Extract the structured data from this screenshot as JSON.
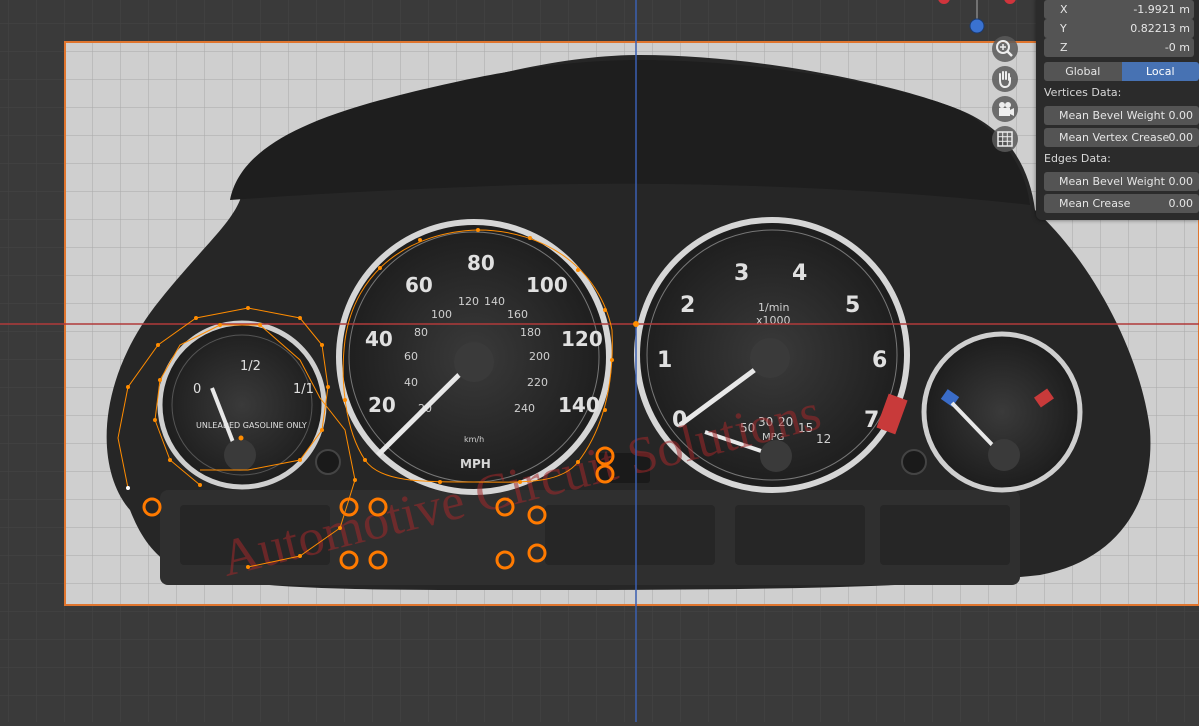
{
  "panel": {
    "x_label": "X",
    "x_value": "-1.9921 m",
    "y_label": "Y",
    "y_value": "0.82213 m",
    "z_label": "Z",
    "z_value": "-0 m",
    "global_label": "Global",
    "local_label": "Local",
    "vertices_header": "Vertices Data:",
    "mean_bevel_weight_label": "Mean Bevel Weight",
    "mean_bevel_weight_value": "0.00",
    "mean_vertex_crease_label": "Mean Vertex Crease",
    "mean_vertex_crease_value": "0.00",
    "edges_header": "Edges Data:",
    "edge_mean_bevel_weight_label": "Mean Bevel Weight",
    "edge_mean_bevel_weight_value": "0.00",
    "mean_crease_label": "Mean Crease",
    "mean_crease_value": "0.00"
  },
  "nav_icons": [
    "zoom-icon",
    "hand-pan-icon",
    "camera-icon",
    "grid-ortho-icon"
  ],
  "cluster": {
    "speedo_ticks": [
      "20",
      "40",
      "60",
      "80",
      "100",
      "120",
      "140"
    ],
    "speedo_inner": [
      "20",
      "40",
      "60",
      "80",
      "100",
      "120",
      "140",
      "160",
      "180",
      "200",
      "220",
      "240"
    ],
    "speedo_unit": "MPH",
    "speedo_kmh": "km/h",
    "tach_ticks": [
      "0",
      "1",
      "2",
      "3",
      "4",
      "5",
      "6",
      "7"
    ],
    "tach_unit": "1/min",
    "tach_mult": "x1000",
    "mpg_ticks": [
      "50",
      "30",
      "20",
      "15",
      "12"
    ],
    "mpg_label": "MPG",
    "fuel_labels": [
      "0",
      "1/2",
      "1/1"
    ],
    "fuel_text": "UNLEADED GASOLINE ONLY",
    "watermark": "Automotive Circuit Solutions"
  },
  "colors": {
    "accent": "#4772b3",
    "selection": "#ff8c00",
    "axis_x": "#b03a3a",
    "axis_y": "#3a5fb0"
  }
}
